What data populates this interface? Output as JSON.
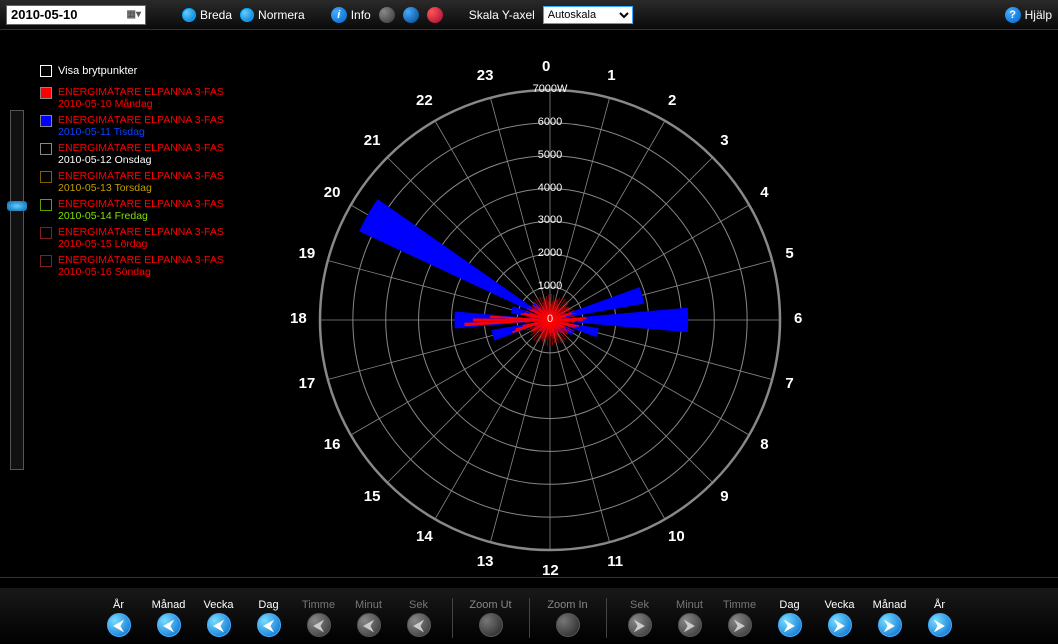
{
  "toolbar": {
    "date": "2010-05-10",
    "breda": "Breda",
    "normera": "Normera",
    "info": "Info",
    "yscale_label": "Skala Y-axel",
    "yscale_value": "Autoskala",
    "help": "Hjälp"
  },
  "breakpoints_label": "Visa brytpunkter",
  "legend": [
    {
      "name": "ENERGIMÄTARE ELPANNA 3-FAS",
      "sub": "2010-05-10 Måndag",
      "fill": "#ff0000",
      "text": "#ff0000",
      "sub_color": "#ff0000"
    },
    {
      "name": "ENERGIMÄTARE ELPANNA 3-FAS",
      "sub": "2010-05-11 Tisdag",
      "fill": "#0000ff",
      "text": "#ff0000",
      "sub_color": "#1040ff"
    },
    {
      "name": "ENERGIMÄTARE ELPANNA 3-FAS",
      "sub": "2010-05-12 Onsdag",
      "fill": "transparent",
      "text": "#ff0000",
      "sub_color": "#ffffff"
    },
    {
      "name": "ENERGIMÄTARE ELPANNA 3-FAS",
      "sub": "2010-05-13 Torsdag",
      "fill": "transparent",
      "text": "#ff0000",
      "sub_color": "#c0a000",
      "border": "#806000"
    },
    {
      "name": "ENERGIMÄTARE ELPANNA 3-FAS",
      "sub": "2010-05-14 Fredag",
      "fill": "transparent",
      "text": "#ff0000",
      "sub_color": "#80e000",
      "border": "#60a000"
    },
    {
      "name": "ENERGIMÄTARE ELPANNA 3-FAS",
      "sub": "2010-05-15 Lördag",
      "fill": "transparent",
      "text": "#ff0000",
      "sub_color": "#ff0000",
      "border": "#802020"
    },
    {
      "name": "ENERGIMÄTARE ELPANNA 3-FAS",
      "sub": "2010-05-16 Söndag",
      "fill": "transparent",
      "text": "#ff0000",
      "sub_color": "#ff0000",
      "border": "#802020"
    }
  ],
  "nav": {
    "left": [
      {
        "label": "År",
        "enabled": true,
        "dir": "left"
      },
      {
        "label": "Månad",
        "enabled": true,
        "dir": "left"
      },
      {
        "label": "Vecka",
        "enabled": true,
        "dir": "left"
      },
      {
        "label": "Dag",
        "enabled": true,
        "dir": "left"
      },
      {
        "label": "Timme",
        "enabled": false,
        "dir": "left"
      },
      {
        "label": "Minut",
        "enabled": false,
        "dir": "left"
      },
      {
        "label": "Sek",
        "enabled": false,
        "dir": "left"
      }
    ],
    "zoom_out": "Zoom Ut",
    "zoom_in": "Zoom In",
    "right": [
      {
        "label": "Sek",
        "enabled": false,
        "dir": "right"
      },
      {
        "label": "Minut",
        "enabled": false,
        "dir": "right"
      },
      {
        "label": "Timme",
        "enabled": false,
        "dir": "right"
      },
      {
        "label": "Dag",
        "enabled": true,
        "dir": "right"
      },
      {
        "label": "Vecka",
        "enabled": true,
        "dir": "right"
      },
      {
        "label": "Månad",
        "enabled": true,
        "dir": "right"
      },
      {
        "label": "År",
        "enabled": true,
        "dir": "right"
      }
    ]
  },
  "chart_data": {
    "type": "polar-bar",
    "title": "",
    "angular_unit": "hour",
    "angular_categories": [
      0,
      1,
      2,
      3,
      4,
      5,
      6,
      7,
      8,
      9,
      10,
      11,
      12,
      13,
      14,
      15,
      16,
      17,
      18,
      19,
      20,
      21,
      22,
      23
    ],
    "radial_label": "W",
    "radial_ticks": [
      0,
      1000,
      2000,
      3000,
      4000,
      5000,
      6000,
      7000
    ],
    "radial_tick_labels": [
      "0",
      "1000",
      "2000",
      "3000",
      "4000",
      "5000",
      "6000",
      "7000W"
    ],
    "rlim": [
      0,
      7000
    ],
    "series": [
      {
        "name": "2010-05-10 Måndag",
        "color": "#ff0000",
        "values": [
          400,
          300,
          250,
          300,
          350,
          700,
          1100,
          900,
          500,
          400,
          300,
          500,
          400,
          300,
          300,
          400,
          600,
          1200,
          2600,
          900,
          700,
          500,
          400,
          350
        ]
      },
      {
        "name": "2010-05-11 Tisdag",
        "color": "#0000ff",
        "values": [
          300,
          250,
          250,
          300,
          400,
          2900,
          4200,
          1500,
          800,
          500,
          400,
          400,
          300,
          300,
          300,
          400,
          500,
          1800,
          2900,
          1200,
          6400,
          700,
          400,
          350
        ]
      }
    ]
  }
}
